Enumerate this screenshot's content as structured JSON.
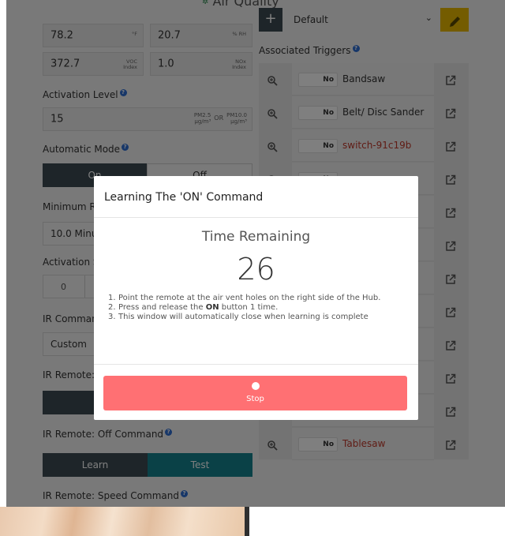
{
  "page": {
    "heading": "Air Quality"
  },
  "sensors": {
    "temp_value": "78.2",
    "temp_unit": "°F",
    "humidity_value": "20.7",
    "humidity_unit": "% RH",
    "voc_value": "372.7",
    "voc_unit_1": "VOC",
    "voc_unit_2": "Index",
    "nox_value": "1.0",
    "nox_unit_1": "NOx",
    "nox_unit_2": "Index"
  },
  "activation_level": {
    "label": "Activation Level",
    "value": "15",
    "unit_a_1": "PM2.5",
    "unit_a_2": "µg/m³",
    "or": "OR",
    "unit_b_1": "PM10.0",
    "unit_b_2": "µg/m³"
  },
  "automatic_mode": {
    "label": "Automatic Mode",
    "on": "On",
    "off": "Off"
  },
  "minimum": {
    "label": "Minimum R",
    "value": "10.0 Minu"
  },
  "activation_s": {
    "label": "Activation S",
    "value": "0"
  },
  "ir_command": {
    "label": "IR Comman",
    "value": "Custom"
  },
  "ir_remote_on": {
    "label": "IR Remote:"
  },
  "ir_remote_off": {
    "label": "IR Remote: Off Command",
    "learn": "Learn",
    "test": "Test"
  },
  "ir_remote_speed": {
    "label": "IR Remote: Speed Command"
  },
  "preset": {
    "value": "Default",
    "add_symbol": "+"
  },
  "triggers": {
    "heading": "Associated Triggers",
    "toggle_label": "No",
    "items": [
      {
        "name": "Bandsaw",
        "red": false
      },
      {
        "name": "Belt/ Disc Sander",
        "red": false
      },
      {
        "name": "switch-91c19b",
        "red": true
      },
      {
        "name": "",
        "red": false
      },
      {
        "name": "",
        "red": false
      },
      {
        "name": "",
        "red": false
      },
      {
        "name": "",
        "red": false
      },
      {
        "name": "",
        "red": false
      },
      {
        "name": "",
        "red": false
      },
      {
        "name": "",
        "red": false
      },
      {
        "name": "",
        "red": false
      },
      {
        "name": "Tablesaw",
        "red": true
      }
    ]
  },
  "modal": {
    "title": "Learning The 'ON' Command",
    "time_label": "Time Remaining",
    "time_value": "26",
    "step_1_num": "1.",
    "step_1": "Point the remote at the air vent holes on the right side of the Hub.",
    "step_2_num": "2.",
    "step_2_pre": "Press and release the ",
    "step_2_bold": "ON",
    "step_2_post": " button 1 time.",
    "step_3_num": "3.",
    "step_3": "This window will automatically close when learning is complete",
    "stop_label": "Stop"
  },
  "colors": {
    "dark_segment": "#3c4a52",
    "teal_segment": "#14838f",
    "stop_button": "#ff7073",
    "edit_button": "#e8b800",
    "help_icon": "#2f6fd3"
  }
}
